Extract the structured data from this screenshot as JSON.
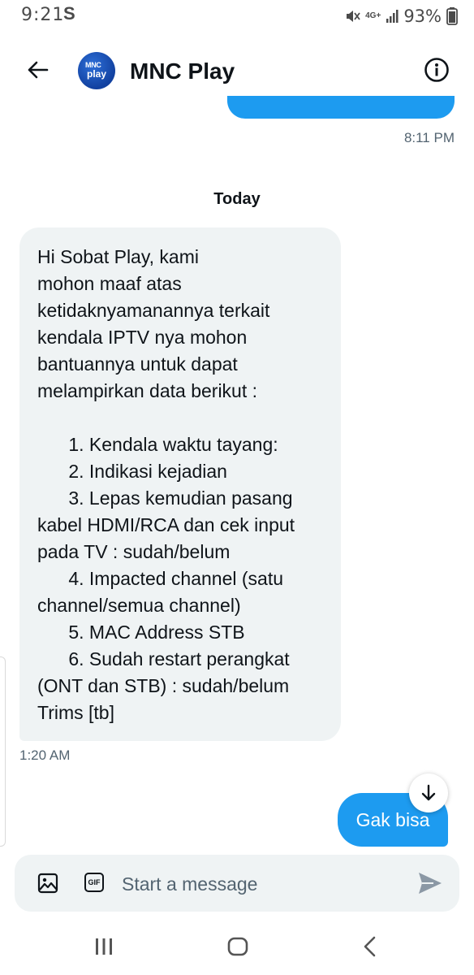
{
  "status_bar": {
    "time": "9:21",
    "carrier_glyph": "S",
    "network_type": "4G+",
    "battery": "93%"
  },
  "header": {
    "contact_name": "MNC Play",
    "avatar_line1": "MNC",
    "avatar_line2": "play"
  },
  "conversation": {
    "previous_message_time": "8:11 PM",
    "day_separator": "Today",
    "incoming_message": "Hi Sobat Play, kami\nmohon maaf atas\nketidaknyamanannya terkait\nkendala IPTV nya mohon\nbantuannya untuk dapat\nmelampirkan data berikut :\n\n      1. Kendala waktu tayang:\n      2. Indikasi kejadian\n      3. Lepas kemudian pasang\nkabel HDMI/RCA dan cek input\npada TV : sudah/belum\n      4. Impacted channel (satu\nchannel/semua channel)\n      5. MAC Address STB\n      6. Sudah restart perangkat\n(ONT dan STB) : sudah/belum\nTrims [tb]",
    "incoming_time": "1:20 AM",
    "outgoing_message": "Gak bisa"
  },
  "composer": {
    "placeholder": "Start a message",
    "gif_label": "GIF"
  },
  "colors": {
    "accent": "#1d9bf0",
    "incoming_bubble": "#eff3f4",
    "muted_text": "#536471"
  }
}
